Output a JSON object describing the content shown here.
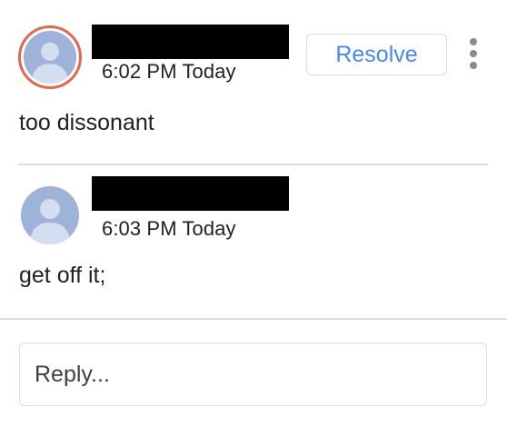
{
  "comments": [
    {
      "author_name": "",
      "timestamp": "6:02 PM Today",
      "body": "too dissonant",
      "avatar_icon": "person-avatar-icon",
      "avatar_ring_color": "#e0684e"
    },
    {
      "author_name": "",
      "timestamp": "6:03 PM Today",
      "body": "get off it;",
      "avatar_icon": "person-avatar-icon"
    }
  ],
  "actions": {
    "resolve_label": "Resolve",
    "more_icon": "more-vert-icon"
  },
  "reply": {
    "placeholder": "Reply...",
    "value": ""
  },
  "colors": {
    "accent": "#4a8ae6",
    "avatar_bg": "#9fb3d8",
    "divider": "#dadce0"
  }
}
